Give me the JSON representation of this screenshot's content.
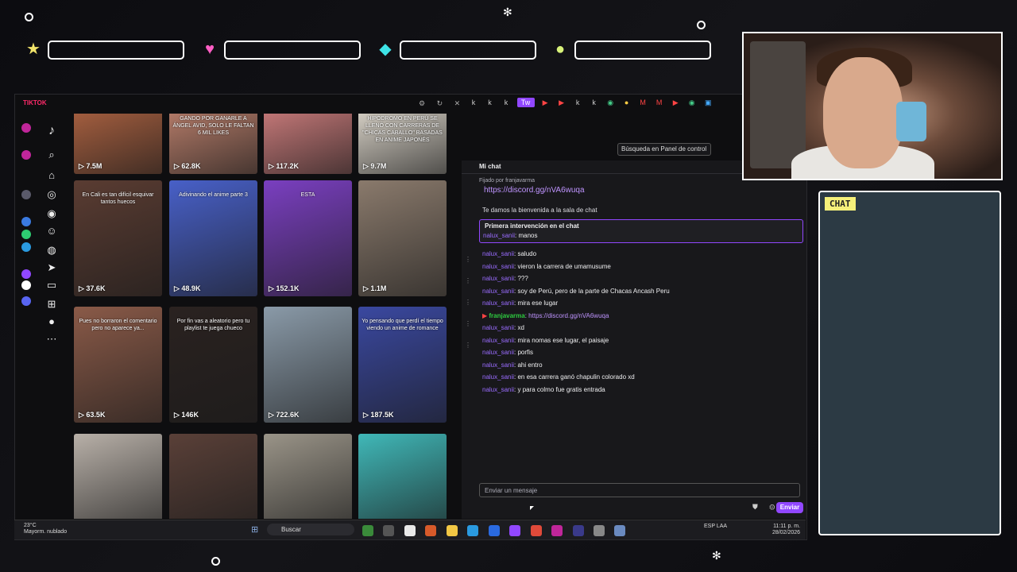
{
  "overlay": {
    "hud_icons": [
      "star-icon",
      "heart-icon",
      "diamond-icon",
      "coin-icon"
    ],
    "colors": {
      "star": "#f2e46a",
      "heart": "#ff5ec4",
      "diamond": "#3ee3e6",
      "coin": "#d8f27a"
    }
  },
  "tiktok": {
    "window_title": "TIKTOK",
    "videos": [
      {
        "views": "7.5M",
        "caption": "",
        "color": "#a86040"
      },
      {
        "views": "62.8K",
        "caption": "GANDO POR GANARLE A ÁNGEL AVID, SOLO LE FALTAN 6 MIL LIKES",
        "color": "#b77d6a"
      },
      {
        "views": "117.2K",
        "caption": "",
        "color": "#c87a7a"
      },
      {
        "views": "9.7M",
        "caption": "HIPÓDROMO EN PERÚ SE LLENÓ CON CARRERAS DE \"CHICAS CABALLO\" BASADAS EN ANIME JAPONÉS",
        "color": "#d9d3c8"
      },
      {
        "views": "37.6K",
        "caption": "En Cali es tan difícil esquivar tantos huecos",
        "color": "#5a3c32"
      },
      {
        "views": "48.9K",
        "caption": "Adivinando el anime parte 3",
        "color": "#4860c8"
      },
      {
        "views": "152.1K",
        "caption": "ESTA",
        "color": "#7a3fc0"
      },
      {
        "views": "1.1M",
        "caption": "",
        "color": "#8a7a6c"
      },
      {
        "views": "63.5K",
        "caption": "Pues no borraron el comentario pero no aparece ya...",
        "color": "#8a5a48"
      },
      {
        "views": "146K",
        "caption": "Por fin vas a aleatorio pero tu playlist te juega chueco",
        "color": "#2a2220"
      },
      {
        "views": "722.6K",
        "caption": "",
        "color": "#8a9aa8"
      },
      {
        "views": "187.5K",
        "caption": "Yo pensando que perdí el tiempo viendo un anime de romance",
        "color": "#3a48a0"
      },
      {
        "views": "",
        "caption": "",
        "color": "#b8b0a8"
      },
      {
        "views": "",
        "caption": "",
        "color": "#5a4038"
      },
      {
        "views": "",
        "caption": "",
        "color": "#9a9488"
      },
      {
        "views": "",
        "caption": "",
        "color": "#40b8b8"
      }
    ]
  },
  "twitch": {
    "search_placeholder": "Búsqueda en Panel de control",
    "chat_title": "Mi chat",
    "pinned_by": "Fijado por",
    "pinned_user": "franjavarma",
    "pinned_link": "https://discord.gg/nVA6wuqa",
    "welcome": "Te damos la bienvenida a la sala de chat",
    "first_title": "Primera intervención en el chat",
    "first_user": "nalux_sanii",
    "first_text": ": manos",
    "messages": [
      {
        "user": "nalux_sanii",
        "text": ": saludo",
        "type": "normal"
      },
      {
        "user": "nalux_sanii",
        "text": ": vieron la carrera de umamusume",
        "type": "normal"
      },
      {
        "user": "nalux_sanii",
        "text": ": ???",
        "type": "normal"
      },
      {
        "user": "nalux_sanii",
        "text": ": soy de Perú, pero de la parte de Chacas Ancash Peru",
        "type": "normal"
      },
      {
        "user": "nalux_sanii",
        "text": ": mira ese lugar",
        "type": "normal"
      },
      {
        "user": "franjavarma",
        "text": ": https://discord.gg/nVA6wuqa",
        "type": "broadcaster"
      },
      {
        "user": "nalux_sanii",
        "text": ": xd",
        "type": "normal"
      },
      {
        "user": "nalux_sanii",
        "text": ": mira nomas ese lugar, el paisaje",
        "type": "normal"
      },
      {
        "user": "nalux_sanii",
        "text": ": porfis",
        "type": "normal"
      },
      {
        "user": "nalux_sanii",
        "text": ": ahi entro",
        "type": "normal"
      },
      {
        "user": "nalux_sanii",
        "text": ": en esa carrera ganó chapulin colorado xd",
        "type": "normal"
      },
      {
        "user": "nalux_sanii",
        "text": ": y para colmo fue gratis entrada",
        "type": "normal"
      }
    ],
    "input_placeholder": "Enviar un mensaje",
    "send_label": "Enviar"
  },
  "taskbar": {
    "temperature": "23°C",
    "weather": "Mayorm. nublado",
    "search_label": "Buscar",
    "lang_top": "ESP",
    "lang_bottom": "LAA",
    "time": "11:11 p. m.",
    "date": "28/02/2026"
  },
  "chatbox": {
    "label": "CHAT"
  }
}
